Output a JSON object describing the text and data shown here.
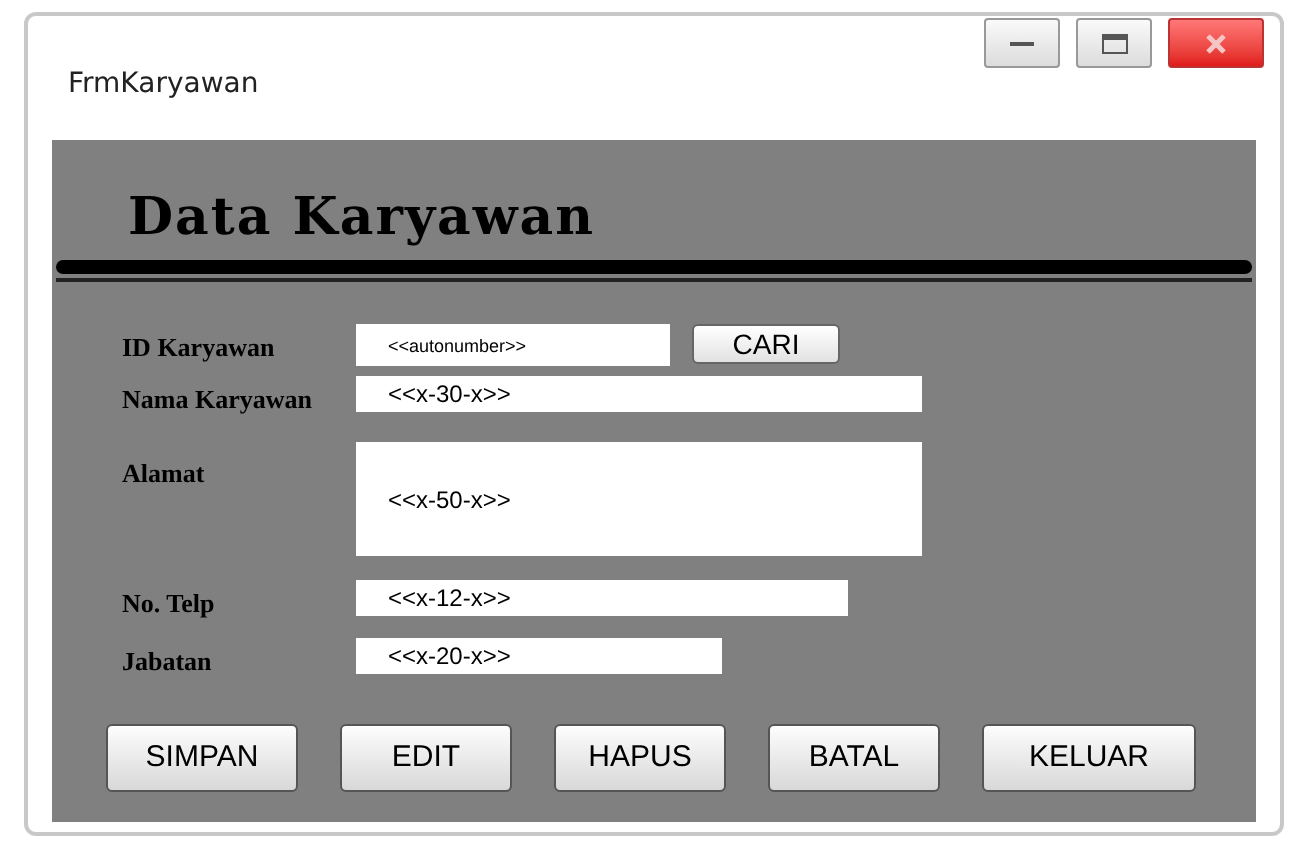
{
  "window": {
    "title": "FrmKaryawan"
  },
  "heading": "Data Karyawan",
  "fields": [
    {
      "label": "ID Karyawan",
      "value": "<<autonumber>>",
      "button": "CARI"
    },
    {
      "label": "Nama Karyawan",
      "value": "<<x-30-x>>"
    },
    {
      "label": "Alamat",
      "value": "<<x-50-x>>",
      "kind": "multiline"
    },
    {
      "label": "No. Telp",
      "value": "<<x-12-x>>"
    },
    {
      "label": "Jabatan",
      "value": "<<x-20-x>>"
    }
  ],
  "buttons": [
    "SIMPAN",
    "EDIT",
    "HAPUS",
    "BATAL",
    "KELUAR"
  ]
}
